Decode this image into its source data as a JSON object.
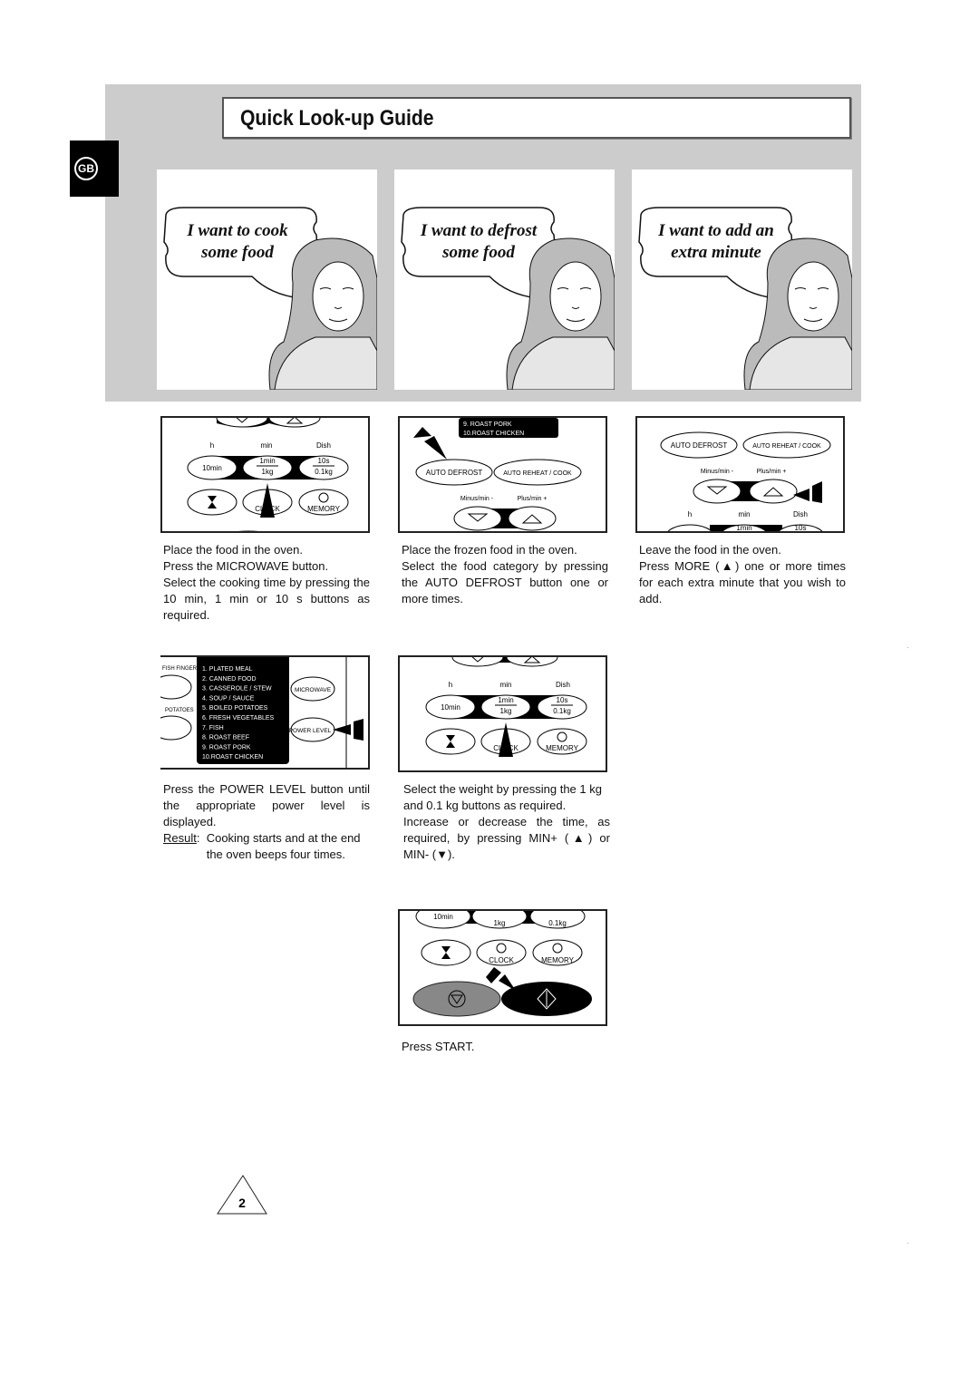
{
  "header": {
    "title": "Quick Look-up Guide",
    "language_tab": "GB"
  },
  "panels": [
    {
      "speech": [
        "I want to cook",
        "some food"
      ]
    },
    {
      "speech": [
        "I want to defrost",
        "some food"
      ]
    },
    {
      "speech": [
        "I want to add an",
        "extra minute"
      ]
    }
  ],
  "keypad": {
    "h": "h",
    "min": "min",
    "dish": "Dish",
    "btn_10min": "10min",
    "btn_1min": "1min",
    "btn_1kg": "1kg",
    "btn_10s": "10s",
    "btn_01kg": "0.1kg",
    "clock": "CLOCK",
    "memory": "MEMORY",
    "memory_icon": "PM",
    "auto_defrost": "AUTO DEFROST",
    "auto_reheat": "AUTO REHEAT / COOK",
    "minus_min": "Minus/min -",
    "plus_min": "Plus/min +",
    "microwave": "MICROWAVE",
    "power_level": "POWER LEVEL",
    "fish_finger": "FISH FINGER",
    "potatoes": "POTATOES",
    "menu_items": [
      "1. PLATED MEAL",
      "2. CANNED FOOD",
      "3. CASSEROLE / STEW",
      "4. SOUP / SAUCE",
      "5. BOILED POTATOES",
      "6. FRESH VEGETABLES",
      "7. FISH",
      "8. ROAST BEEF",
      "9. ROAST PORK",
      "10.ROAST CHICKEN"
    ]
  },
  "steps": {
    "cook_1": [
      "Place the food in the oven.",
      "Press the MICROWAVE button.",
      "Select the cooking time by pressing the 10 min, 1 min or 10 s buttons as required."
    ],
    "defrost_1": [
      "Place the frozen food in the oven.",
      "Select the food category by pressing the AUTO DEFROST button one or more times."
    ],
    "extra_1": [
      "Leave the food in the oven.",
      "Press MORE (▲) one or more times for each extra minute that you wish to add."
    ],
    "cook_2": "Press the POWER LEVEL button until the appropriate power level is displayed.",
    "cook_2_result_label": "Result",
    "cook_2_result": "Cooking starts and at the end the oven beeps four times.",
    "defrost_2": [
      "Select the weight by pressing the 1 kg and 0.1 kg buttons as required.",
      "Increase or decrease the time, as required, by pressing MIN+ (▲) or MIN- (▼)."
    ],
    "defrost_3": "Press START."
  },
  "footer": {
    "page_number": "2"
  }
}
